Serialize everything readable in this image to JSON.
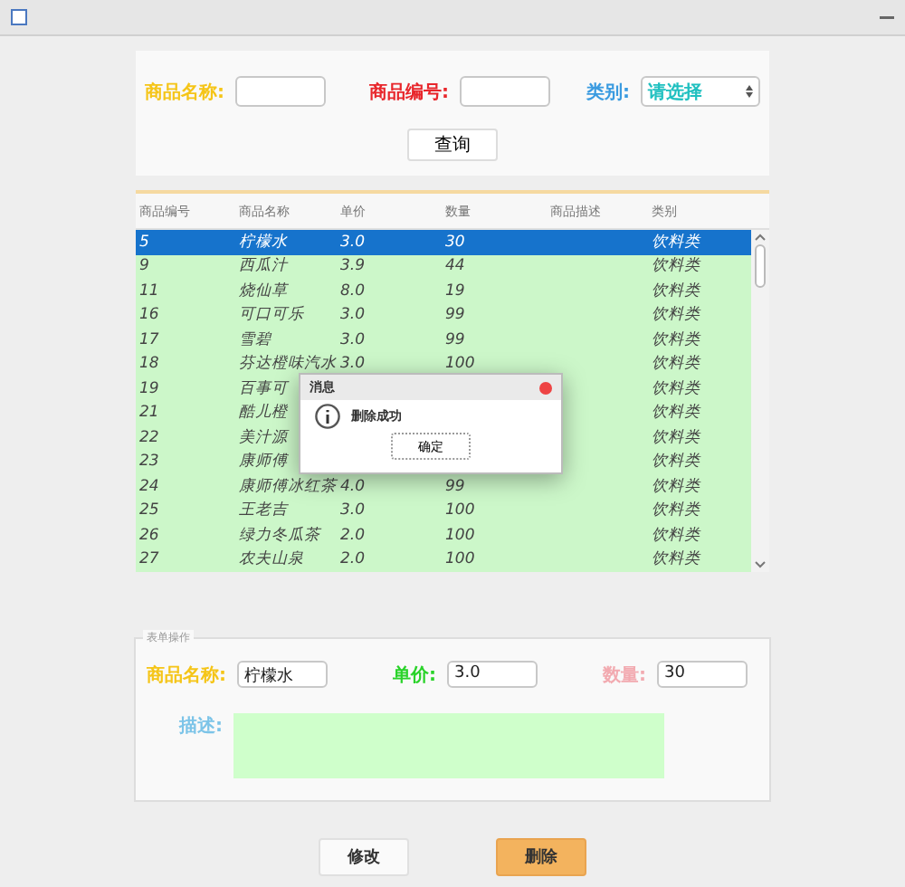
{
  "search": {
    "fields": [
      {
        "label": "商品名称:",
        "color": "#f5c518",
        "kind": "text"
      },
      {
        "label": "商品编号:",
        "color": "#e8262b",
        "kind": "text"
      },
      {
        "label": "类别:",
        "color": "#3a9be0",
        "kind": "select",
        "value": "请选择"
      }
    ],
    "button": "查询"
  },
  "table": {
    "columns": [
      "商品编号",
      "商品名称",
      "单价",
      "数量",
      "商品描述",
      "类别"
    ],
    "rows": [
      {
        "cells": [
          "5",
          "柠檬水",
          "3.0",
          "30",
          "",
          "饮料类"
        ],
        "selected": true
      },
      {
        "cells": [
          "9",
          "西瓜汁",
          "3.9",
          "44",
          "",
          "饮料类"
        ],
        "selected": false
      },
      {
        "cells": [
          "11",
          "烧仙草",
          "8.0",
          "19",
          "",
          "饮料类"
        ],
        "selected": false
      },
      {
        "cells": [
          "16",
          "可口可乐",
          "3.0",
          "99",
          "",
          "饮料类"
        ],
        "selected": false
      },
      {
        "cells": [
          "17",
          "雪碧",
          "3.0",
          "99",
          "",
          "饮料类"
        ],
        "selected": false
      },
      {
        "cells": [
          "18",
          "芬达橙味汽水",
          "3.0",
          "100",
          "",
          "饮料类"
        ],
        "selected": false
      },
      {
        "cells": [
          "19",
          "百事可",
          "",
          "",
          "",
          "饮料类"
        ],
        "selected": false
      },
      {
        "cells": [
          "21",
          "酷儿橙",
          "",
          "",
          "",
          "饮料类"
        ],
        "selected": false
      },
      {
        "cells": [
          "22",
          "美汁源",
          "",
          "",
          "",
          "饮料类"
        ],
        "selected": false
      },
      {
        "cells": [
          "23",
          "康师傅",
          "",
          "",
          "",
          "饮料类"
        ],
        "selected": false
      },
      {
        "cells": [
          "24",
          "康师傅冰红茶",
          "4.0",
          "99",
          "",
          "饮料类"
        ],
        "selected": false
      },
      {
        "cells": [
          "25",
          "王老吉",
          "3.0",
          "100",
          "",
          "饮料类"
        ],
        "selected": false
      },
      {
        "cells": [
          "26",
          "绿力冬瓜茶",
          "2.0",
          "100",
          "",
          "饮料类"
        ],
        "selected": false
      },
      {
        "cells": [
          "27",
          "农夫山泉",
          "2.0",
          "100",
          "",
          "饮料类"
        ],
        "selected": false
      }
    ]
  },
  "dialog": {
    "title": "消息",
    "message": "删除成功",
    "button": "确定"
  },
  "edit": {
    "legend": "表单操作",
    "fields": [
      {
        "label": "商品名称:",
        "color": "#f5c518",
        "value": "柠檬水"
      },
      {
        "label": "单价:",
        "color": "#2ad32a",
        "value": "3.0"
      },
      {
        "label": "数量:",
        "color": "#f2aab0",
        "value": "30"
      }
    ],
    "description": {
      "label": "描述:",
      "color": "#7cc4e8"
    }
  },
  "buttons": [
    {
      "label": "修改",
      "kind": "plain"
    },
    {
      "label": "删除",
      "kind": "primary"
    }
  ]
}
